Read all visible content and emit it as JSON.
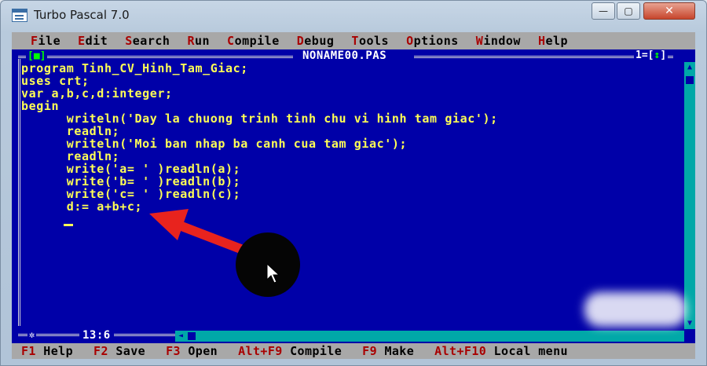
{
  "window": {
    "title": "Turbo Pascal 7.0",
    "minimize_glyph": "—",
    "maximize_glyph": "▢",
    "close_glyph": "✕"
  },
  "menu": [
    {
      "hk": "F",
      "rest": "ile"
    },
    {
      "hk": "E",
      "rest": "dit"
    },
    {
      "hk": "S",
      "rest": "earch"
    },
    {
      "hk": "R",
      "rest": "un"
    },
    {
      "hk": "C",
      "rest": "ompile"
    },
    {
      "hk": "D",
      "rest": "ebug"
    },
    {
      "hk": "T",
      "rest": "ools"
    },
    {
      "hk": "O",
      "rest": "ptions"
    },
    {
      "hk": "W",
      "rest": "indow"
    },
    {
      "hk": "H",
      "rest": "elp"
    }
  ],
  "editor": {
    "file_name": "NONAME00.PAS",
    "close_box_left": "[",
    "close_box_mark": "■",
    "close_box_right": "]",
    "window_number": "1=[",
    "zoom_mark": "↕",
    "window_number_end": "]",
    "cursor_position": "13:6",
    "lines": [
      "program Tinh_CV_Hinh_Tam_Giac;",
      "uses crt;",
      "var a,b,c,d:integer;",
      "begin",
      "      writeln('Day la chuong trinh tinh chu vi hinh tam giac');",
      "      readln;",
      "      writeln('Moi ban nhap ba canh cua tam giac');",
      "      readln;",
      "      write('a= ' )readln(a);",
      "      write('b= ' )readln(b);",
      "      write('c= ' )readln(c);",
      "      d:= a+b+c;"
    ]
  },
  "function_keys": [
    {
      "key": "F1",
      "label": " Help"
    },
    {
      "key": "F2",
      "label": " Save"
    },
    {
      "key": "F3",
      "label": " Open"
    },
    {
      "key": "Alt+F9",
      "label": " Compile"
    },
    {
      "key": "F9",
      "label": " Make"
    },
    {
      "key": "Alt+F10",
      "label": " Local menu"
    }
  ],
  "colors": {
    "editor_bg": "#0000a8",
    "code_text": "#ffff55",
    "menu_bg": "#a8a8a8",
    "hotkey": "#a80000",
    "arrow": "#e8231e"
  },
  "icons": [
    "app-icon",
    "close-box-icon",
    "zoom-icon",
    "scroll-up-icon",
    "scroll-down-icon",
    "scroll-left-icon",
    "star-icon",
    "mouse-pointer-icon",
    "red-arrow-icon"
  ]
}
